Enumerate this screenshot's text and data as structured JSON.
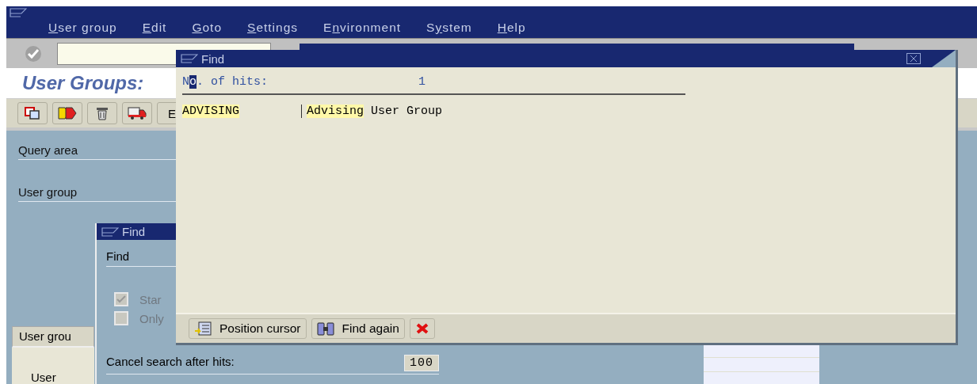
{
  "menu_bar": {
    "items": [
      {
        "key": "U",
        "after": "ser group"
      },
      {
        "key": "E",
        "after": "dit"
      },
      {
        "key": "G",
        "after": "oto"
      },
      {
        "key": "S",
        "after": "ettings"
      },
      {
        "before": "E",
        "key": "n",
        "after": "vironment"
      },
      {
        "before": "S",
        "key": "y",
        "after": "stem"
      },
      {
        "key": "H",
        "after": "elp"
      }
    ]
  },
  "title": "User Groups:",
  "app_toolbar": {
    "text_button": "E"
  },
  "fields": [
    {
      "label": "Query area"
    },
    {
      "label": "User group"
    }
  ],
  "find_dialog_back": {
    "title": "Find",
    "section": "Find",
    "options": [
      {
        "label": "Star",
        "checked": true,
        "disabled": true
      },
      {
        "label": "Only",
        "checked": false,
        "disabled": true
      }
    ],
    "cancel_label": "Cancel search after hits:",
    "cancel_value": "100"
  },
  "table_tab": {
    "header": "User grou",
    "cell": "User"
  },
  "find_dialog": {
    "title": "Find",
    "hits_label_parts": [
      "N",
      "o",
      ". of hits:"
    ],
    "hits_count": "1",
    "results": [
      {
        "key": "ADVISING",
        "desc_highlight": "Advising",
        "desc_rest": " User Group"
      }
    ],
    "buttons": [
      {
        "kind": "position",
        "label": "Position cursor"
      },
      {
        "kind": "find",
        "label": "Find again"
      },
      {
        "kind": "cancel"
      }
    ]
  }
}
